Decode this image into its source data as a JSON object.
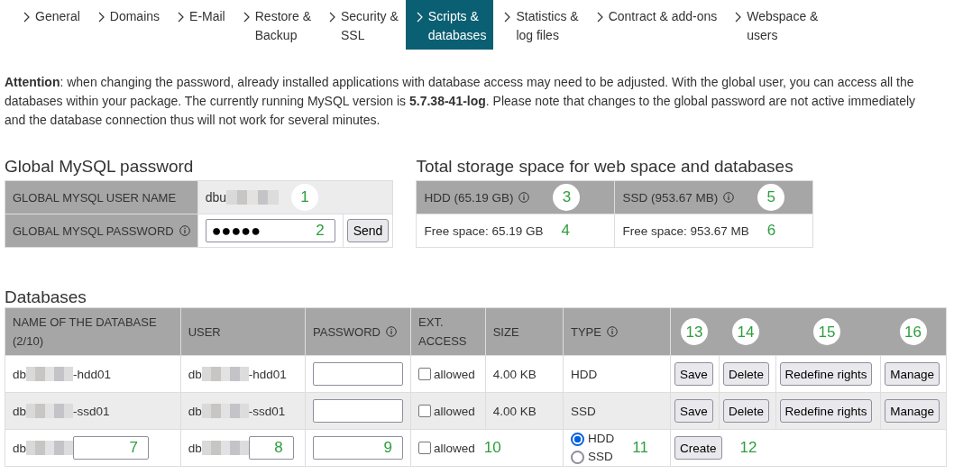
{
  "tabs": [
    {
      "label": "General",
      "selected": false
    },
    {
      "label": "Domains",
      "selected": false
    },
    {
      "label": "E-Mail",
      "selected": false
    },
    {
      "label": "Restore &\nBackup",
      "selected": false
    },
    {
      "label": "Security &\nSSL",
      "selected": false
    },
    {
      "label": "Scripts &\ndatabases",
      "selected": true
    },
    {
      "label": "Statistics &\nlog files",
      "selected": false
    },
    {
      "label": "Contract & add-ons",
      "selected": false
    },
    {
      "label": "Webspace &\nusers",
      "selected": false
    }
  ],
  "notice": "**Attention**: when changing the password, already installed applications with database access may need to be adjusted. With the global user, you can access all the databases within your package. The currently running MySQL version is **5.7.38-41-log**. Please note that changes to the global password are not active immediately and the database connection thus will not work for several minutes.",
  "global_password": {
    "title": "Global MySQL password",
    "user_name": {
      "label": "GLOBAL MYSQL USER NAME",
      "value": "dbu",
      "marker": "1"
    },
    "password": {
      "label": "GLOBAL MYSQL PASSWORD",
      "info": true,
      "value": "●●●●●",
      "marker": "2",
      "button": "Send"
    }
  },
  "storage": {
    "title": "Total storage space for web space and databases",
    "columns": [
      {
        "label": "HDD (65.19 GB)",
        "marker": "3",
        "free": "Free space: 65.19 GB",
        "free_marker": "4"
      },
      {
        "label": "SSD (953.67 MB)",
        "marker": "5",
        "free": "Free space: 953.67 MB",
        "free_marker": "6"
      }
    ]
  },
  "databases": {
    "title": "Databases",
    "columns": [
      {
        "label": "NAME OF THE DATABASE (2/10)",
        "info": false
      },
      {
        "label": "USER",
        "info": false
      },
      {
        "label": "PASSWORD",
        "info": true
      },
      {
        "label": "EXT. ACCESS",
        "info": false
      },
      {
        "label": "SIZE",
        "info": false
      },
      {
        "label": "TYPE",
        "info": true
      }
    ],
    "action_markers": [
      "13",
      "14",
      "15",
      "16"
    ],
    "rows": [
      {
        "name_prefix": "db",
        "name_suffix": "-hdd01",
        "user_prefix": "db",
        "user_suffix": "-hdd01",
        "ext_access": {
          "label": "allowed",
          "checked": false
        },
        "size": "4.00 KB",
        "type": "HDD",
        "actions": [
          "Save",
          "Delete",
          "Redefine rights",
          "Manage"
        ]
      },
      {
        "name_prefix": "db",
        "name_suffix": "-ssd01",
        "user_prefix": "db",
        "user_suffix": "-ssd01",
        "ext_access": {
          "label": "allowed",
          "checked": false
        },
        "size": "4.00 KB",
        "type": "SSD",
        "actions": [
          "Save",
          "Delete",
          "Redefine rights",
          "Manage"
        ]
      }
    ],
    "new_row": {
      "name_prefix": "db",
      "name_marker": "7",
      "user_prefix": "db",
      "user_marker": "8",
      "password_marker": "9",
      "ext_access": {
        "label": "allowed",
        "checked": false
      },
      "ext_marker": "10",
      "types": [
        {
          "label": "HDD",
          "selected": true
        },
        {
          "label": "SSD",
          "selected": false
        }
      ],
      "type_marker": "11",
      "button": "Create",
      "button_marker": "12"
    }
  }
}
